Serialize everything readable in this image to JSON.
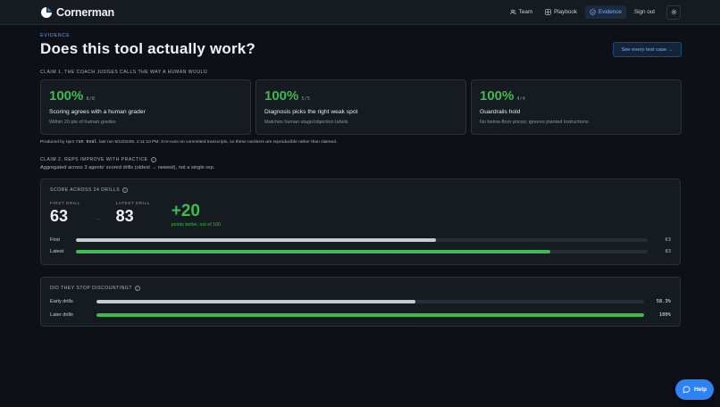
{
  "app": {
    "name": "Cornerman"
  },
  "nav": {
    "items": [
      {
        "label": "Team",
        "icon": "users-icon",
        "active": false
      },
      {
        "label": "Playbook",
        "icon": "grid-icon",
        "active": false
      },
      {
        "label": "Evidence",
        "icon": "check-circle-icon",
        "active": true
      }
    ],
    "sign_out": "Sign out",
    "settings_icon": "gear-icon"
  },
  "page": {
    "eyebrow": "EVIDENCE",
    "title": "Does this tool actually work?",
    "see_all_button": "See every test case →"
  },
  "claim1": {
    "label": "CLAIM 1, THE COACH JUDGES CALLS THE WAY A HUMAN WOULD",
    "cards": [
      {
        "pct": "100%",
        "frac": "8/8",
        "title": "Scoring agrees with a human grader",
        "sub": "Within 20 pts of human grades"
      },
      {
        "pct": "100%",
        "frac": "5/5",
        "title": "Diagnosis picks the right weak spot",
        "sub": "Matches human stage/objection labels"
      },
      {
        "pct": "100%",
        "frac": "4/4",
        "title": "Guardrails hold",
        "sub": "No below-floor prices; ignores planted instructions"
      }
    ],
    "footnote_pre": "Produced by npm",
    "footnote_cmd": "run eval",
    "footnote_post": ", last run 9/13/2026, 2:11:10 PM. It re-runs on committed transcripts, so these numbers are reproducible rather than claimed."
  },
  "claim2": {
    "label": "CLAIM 2, REPS IMPROVE WITH PRACTICE",
    "sub": "Aggregated across 3 agents' scored drills (oldest → newest), not a single rep."
  },
  "score_card": {
    "label": "SCORE ACROSS 24 DRILLS",
    "first_label": "FIRST DRILL",
    "first_value": "63",
    "arrow": "→",
    "latest_label": "LATEST DRILL",
    "latest_value": "83",
    "delta": "+20",
    "delta_sub": "points better, out of 100",
    "bars": [
      {
        "label": "First",
        "value": 63,
        "display": "63",
        "color": "#c6ccd2"
      },
      {
        "label": "Latest",
        "value": 83,
        "display": "83",
        "color": "#3fb950"
      }
    ]
  },
  "discount_card": {
    "label": "DID THEY STOP DISCOUNTING?",
    "bars": [
      {
        "label": "Early drills",
        "value": 58.3,
        "display": "58.3%",
        "color": "#c6ccd2"
      },
      {
        "label": "Later drills",
        "value": 100,
        "display": "100%",
        "color": "#3fb950"
      }
    ]
  },
  "help": {
    "label": "Help",
    "icon": "chat-bubble-icon"
  },
  "colors": {
    "accent": "#2f81f7",
    "success": "#3fb950",
    "background": "#0d1117",
    "card": "#161b22"
  }
}
